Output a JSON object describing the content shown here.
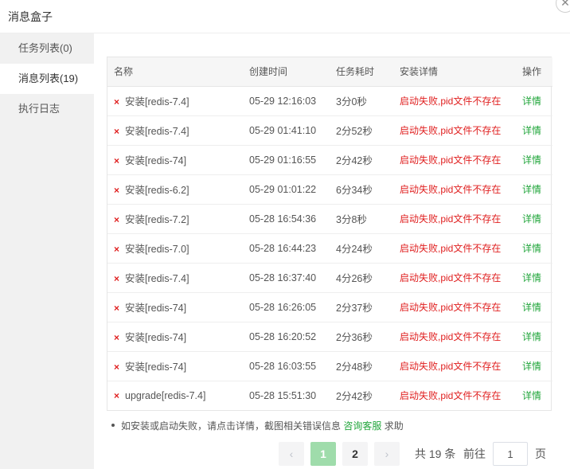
{
  "dialog": {
    "title": "消息盒子",
    "close_glyph": "✕"
  },
  "sidebar": {
    "items": [
      {
        "label": "任务列表(0)"
      },
      {
        "label": "消息列表(19)"
      },
      {
        "label": "执行日志"
      }
    ],
    "active_index": 1
  },
  "table": {
    "headers": {
      "name": "名称",
      "time": "创建时间",
      "duration": "任务耗时",
      "detail": "安装详情",
      "op": "操作"
    },
    "fail_icon": "×",
    "rows": [
      {
        "name": "安装[redis-7.4]",
        "time": "05-29 12:16:03",
        "duration": "3分0秒",
        "detail": "启动失败,pid文件不存在",
        "op": "详情"
      },
      {
        "name": "安装[redis-7.4]",
        "time": "05-29 01:41:10",
        "duration": "2分52秒",
        "detail": "启动失败,pid文件不存在",
        "op": "详情"
      },
      {
        "name": "安装[redis-74]",
        "time": "05-29 01:16:55",
        "duration": "2分42秒",
        "detail": "启动失败,pid文件不存在",
        "op": "详情"
      },
      {
        "name": "安装[redis-6.2]",
        "time": "05-29 01:01:22",
        "duration": "6分34秒",
        "detail": "启动失败,pid文件不存在",
        "op": "详情"
      },
      {
        "name": "安装[redis-7.2]",
        "time": "05-28 16:54:36",
        "duration": "3分8秒",
        "detail": "启动失败,pid文件不存在",
        "op": "详情"
      },
      {
        "name": "安装[redis-7.0]",
        "time": "05-28 16:44:23",
        "duration": "4分24秒",
        "detail": "启动失败,pid文件不存在",
        "op": "详情"
      },
      {
        "name": "安装[redis-7.4]",
        "time": "05-28 16:37:40",
        "duration": "4分26秒",
        "detail": "启动失败,pid文件不存在",
        "op": "详情"
      },
      {
        "name": "安装[redis-74]",
        "time": "05-28 16:26:05",
        "duration": "2分37秒",
        "detail": "启动失败,pid文件不存在",
        "op": "详情"
      },
      {
        "name": "安装[redis-74]",
        "time": "05-28 16:20:52",
        "duration": "2分36秒",
        "detail": "启动失败,pid文件不存在",
        "op": "详情"
      },
      {
        "name": "安装[redis-74]",
        "time": "05-28 16:03:55",
        "duration": "2分48秒",
        "detail": "启动失败,pid文件不存在",
        "op": "详情"
      },
      {
        "name": "upgrade[redis-7.4]",
        "time": "05-28 15:51:30",
        "duration": "2分42秒",
        "detail": "启动失败,pid文件不存在",
        "op": "详情"
      }
    ]
  },
  "tips": {
    "text": "如安装或启动失败，请点击详情，截图相关错误信息",
    "link": "咨询客服",
    "suffix": "求助"
  },
  "pagination": {
    "prev_glyph": "‹",
    "next_glyph": "›",
    "pages": [
      "1",
      "2"
    ],
    "current": "1",
    "total_text": "共 19 条",
    "goto_label": "前往",
    "goto_value": "1",
    "page_suffix": "页"
  },
  "colors": {
    "accent": "#20a53a",
    "error": "#e02020",
    "active_page_bg": "#9fdcab"
  }
}
